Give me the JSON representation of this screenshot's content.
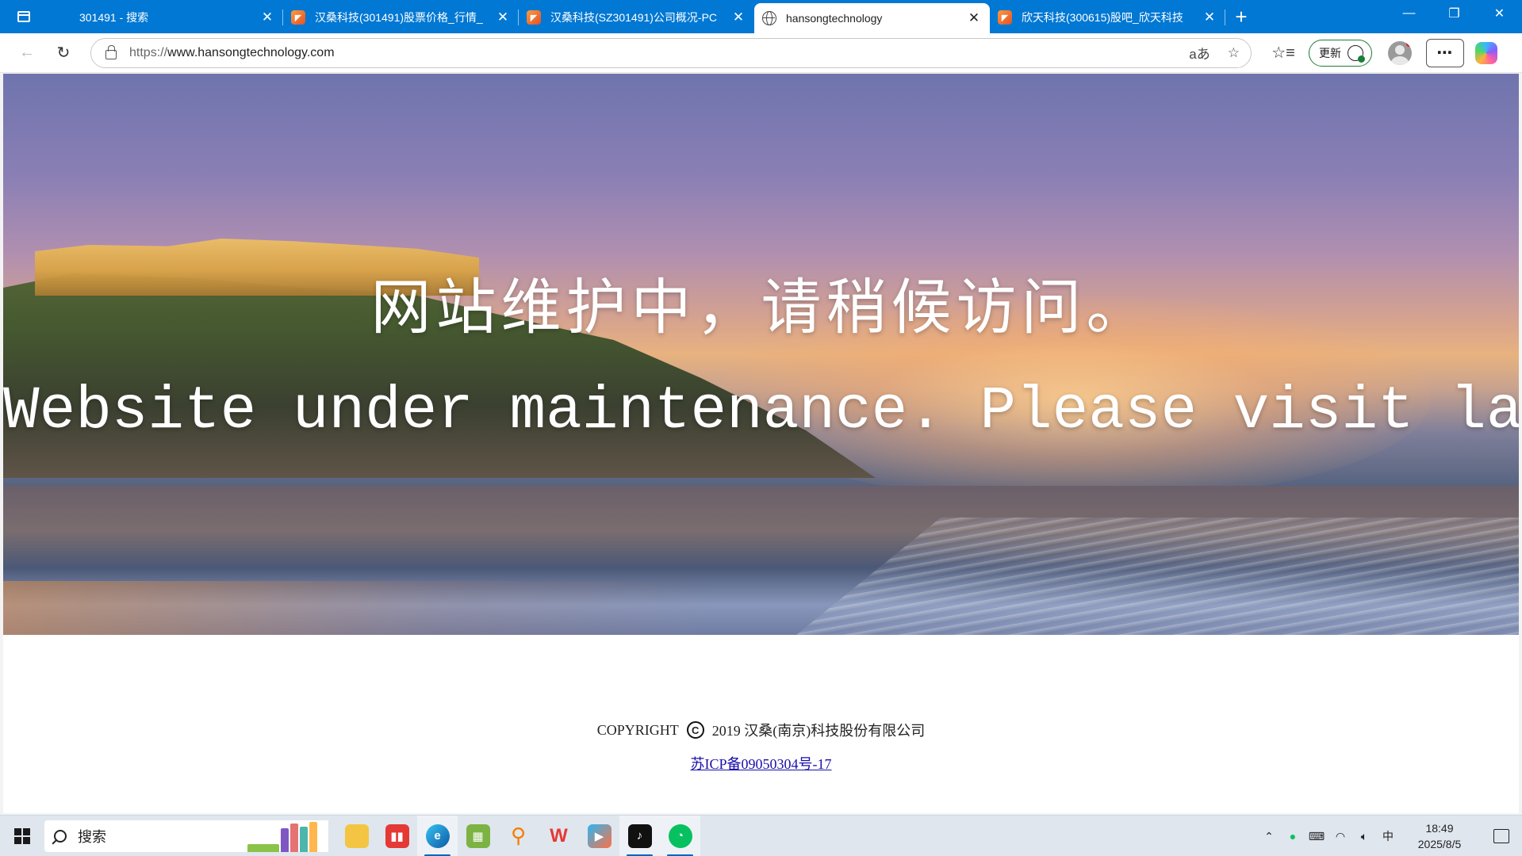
{
  "browser": {
    "tabs": [
      {
        "title": "301491 - 搜索",
        "favicon": "blank"
      },
      {
        "title": "汉桑科技(301491)股票价格_行情_",
        "favicon": "orange"
      },
      {
        "title": "汉桑科技(SZ301491)公司概况-PC",
        "favicon": "orange"
      },
      {
        "title": "hansongtechnology",
        "favicon": "globe",
        "active": true
      },
      {
        "title": "欣天科技(300615)股吧_欣天科技",
        "favicon": "orange"
      }
    ],
    "new_tab_glyph": "+",
    "close_glyph": "✕",
    "window": {
      "minimize": "—",
      "restore": "❐",
      "close": "✕"
    }
  },
  "addressbar": {
    "url_scheme": "https://",
    "url_host": "www.hansongtechnology.com",
    "read_aloud": "aあ",
    "favorite_glyph": "☆",
    "favorites_list_glyph": "☆≡",
    "update_label": "更新",
    "more_glyph": "⋯"
  },
  "page": {
    "message_cn": "网站维护中，请稍候访问。",
    "message_en": "Website under maintenance. Please visit later.",
    "copyright_prefix": "COPYRIGHT",
    "copyright_symbol": "C",
    "copyright_year_company": "2019 汉桑(南京)科技股份有限公司",
    "icp": "苏ICP备09050304号-17"
  },
  "taskbar": {
    "search_label": "搜索",
    "apps": [
      "file-explorer",
      "stock-app",
      "edge",
      "spreadsheet-app",
      "search-app",
      "wps",
      "video-player",
      "tiktok",
      "wechat"
    ],
    "time": "18:49",
    "date": "2025/8/5",
    "tray_ime": "中"
  },
  "colors": {
    "titlebar": "#0078d4",
    "update_border": "#1a7f37",
    "link": "#1a0dab"
  }
}
